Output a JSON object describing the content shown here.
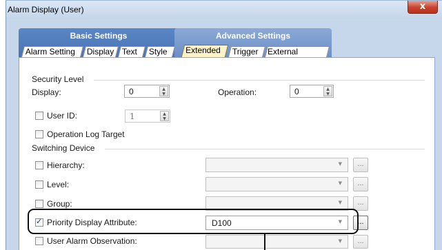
{
  "window": {
    "title": "Alarm Display (User)",
    "close_glyph": "x"
  },
  "tab_groups": [
    {
      "label": "Basic Settings",
      "tabs": [
        "Alarm Setting",
        "Display",
        "Text",
        "Style"
      ]
    },
    {
      "label": "Advanced Settings",
      "tabs": [
        "Extended",
        "Trigger",
        "External Output"
      ],
      "active_tab": "Extended"
    }
  ],
  "security_level": {
    "heading": "Security Level",
    "display_label": "Display:",
    "display_value": "0",
    "operation_label": "Operation:",
    "operation_value": "0"
  },
  "user_id": {
    "label": "User ID:",
    "value": "1",
    "checked": false
  },
  "operation_log": {
    "label": "Operation Log Target",
    "checked": false
  },
  "switching_device": {
    "heading": "Switching Device",
    "rows": [
      {
        "label": "Hierarchy:",
        "checked": false,
        "value": "",
        "ellipsis": "..."
      },
      {
        "label": "Level:",
        "checked": false,
        "value": "",
        "ellipsis": "..."
      },
      {
        "label": "Group:",
        "checked": false,
        "value": "",
        "ellipsis": "..."
      },
      {
        "label": "Priority Display Attribute:",
        "checked": true,
        "value": "D100",
        "ellipsis": "..."
      },
      {
        "label": "User Alarm Observation:",
        "checked": false,
        "value": "",
        "ellipsis": "..."
      }
    ]
  },
  "icons": {
    "spin": "spin-up-down-icon",
    "dropdown": "chevron-down-icon",
    "check": "checkmark-icon"
  },
  "colors": {
    "window_bg": "#c6d7ec",
    "basic_group": "#4a73b2",
    "advanced_group": "#6d8fc6",
    "active_tab": "#fdf3c8",
    "close_button": "#c8412c"
  }
}
